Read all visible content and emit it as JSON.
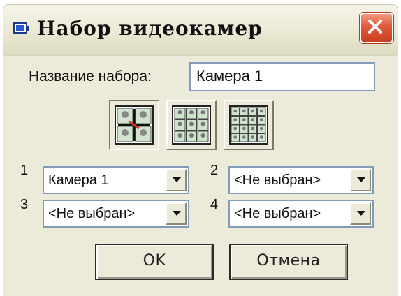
{
  "window": {
    "title": "Набор видеокамер",
    "icon": "monitor-icon",
    "close_icon": "close-icon"
  },
  "set_name": {
    "label": "Название набора:",
    "value": "Камера 1"
  },
  "layouts": [
    {
      "icon": "layout-2x2-icon",
      "state": "pressed"
    },
    {
      "icon": "layout-3x3-icon",
      "state": "raised"
    },
    {
      "icon": "layout-4x4-icon",
      "state": "raised"
    }
  ],
  "cameras": [
    {
      "number": "1",
      "selected": "Камера 1"
    },
    {
      "number": "2",
      "selected": "<Не выбран>"
    },
    {
      "number": "3",
      "selected": "<Не выбран>"
    },
    {
      "number": "4",
      "selected": "<Не выбран>"
    }
  ],
  "buttons": {
    "ok": "OK",
    "cancel": "Отмена"
  },
  "colors": {
    "dialog_bg": "#ecead9",
    "close_button": "#e2583a",
    "field_border": "#7f9db9"
  }
}
